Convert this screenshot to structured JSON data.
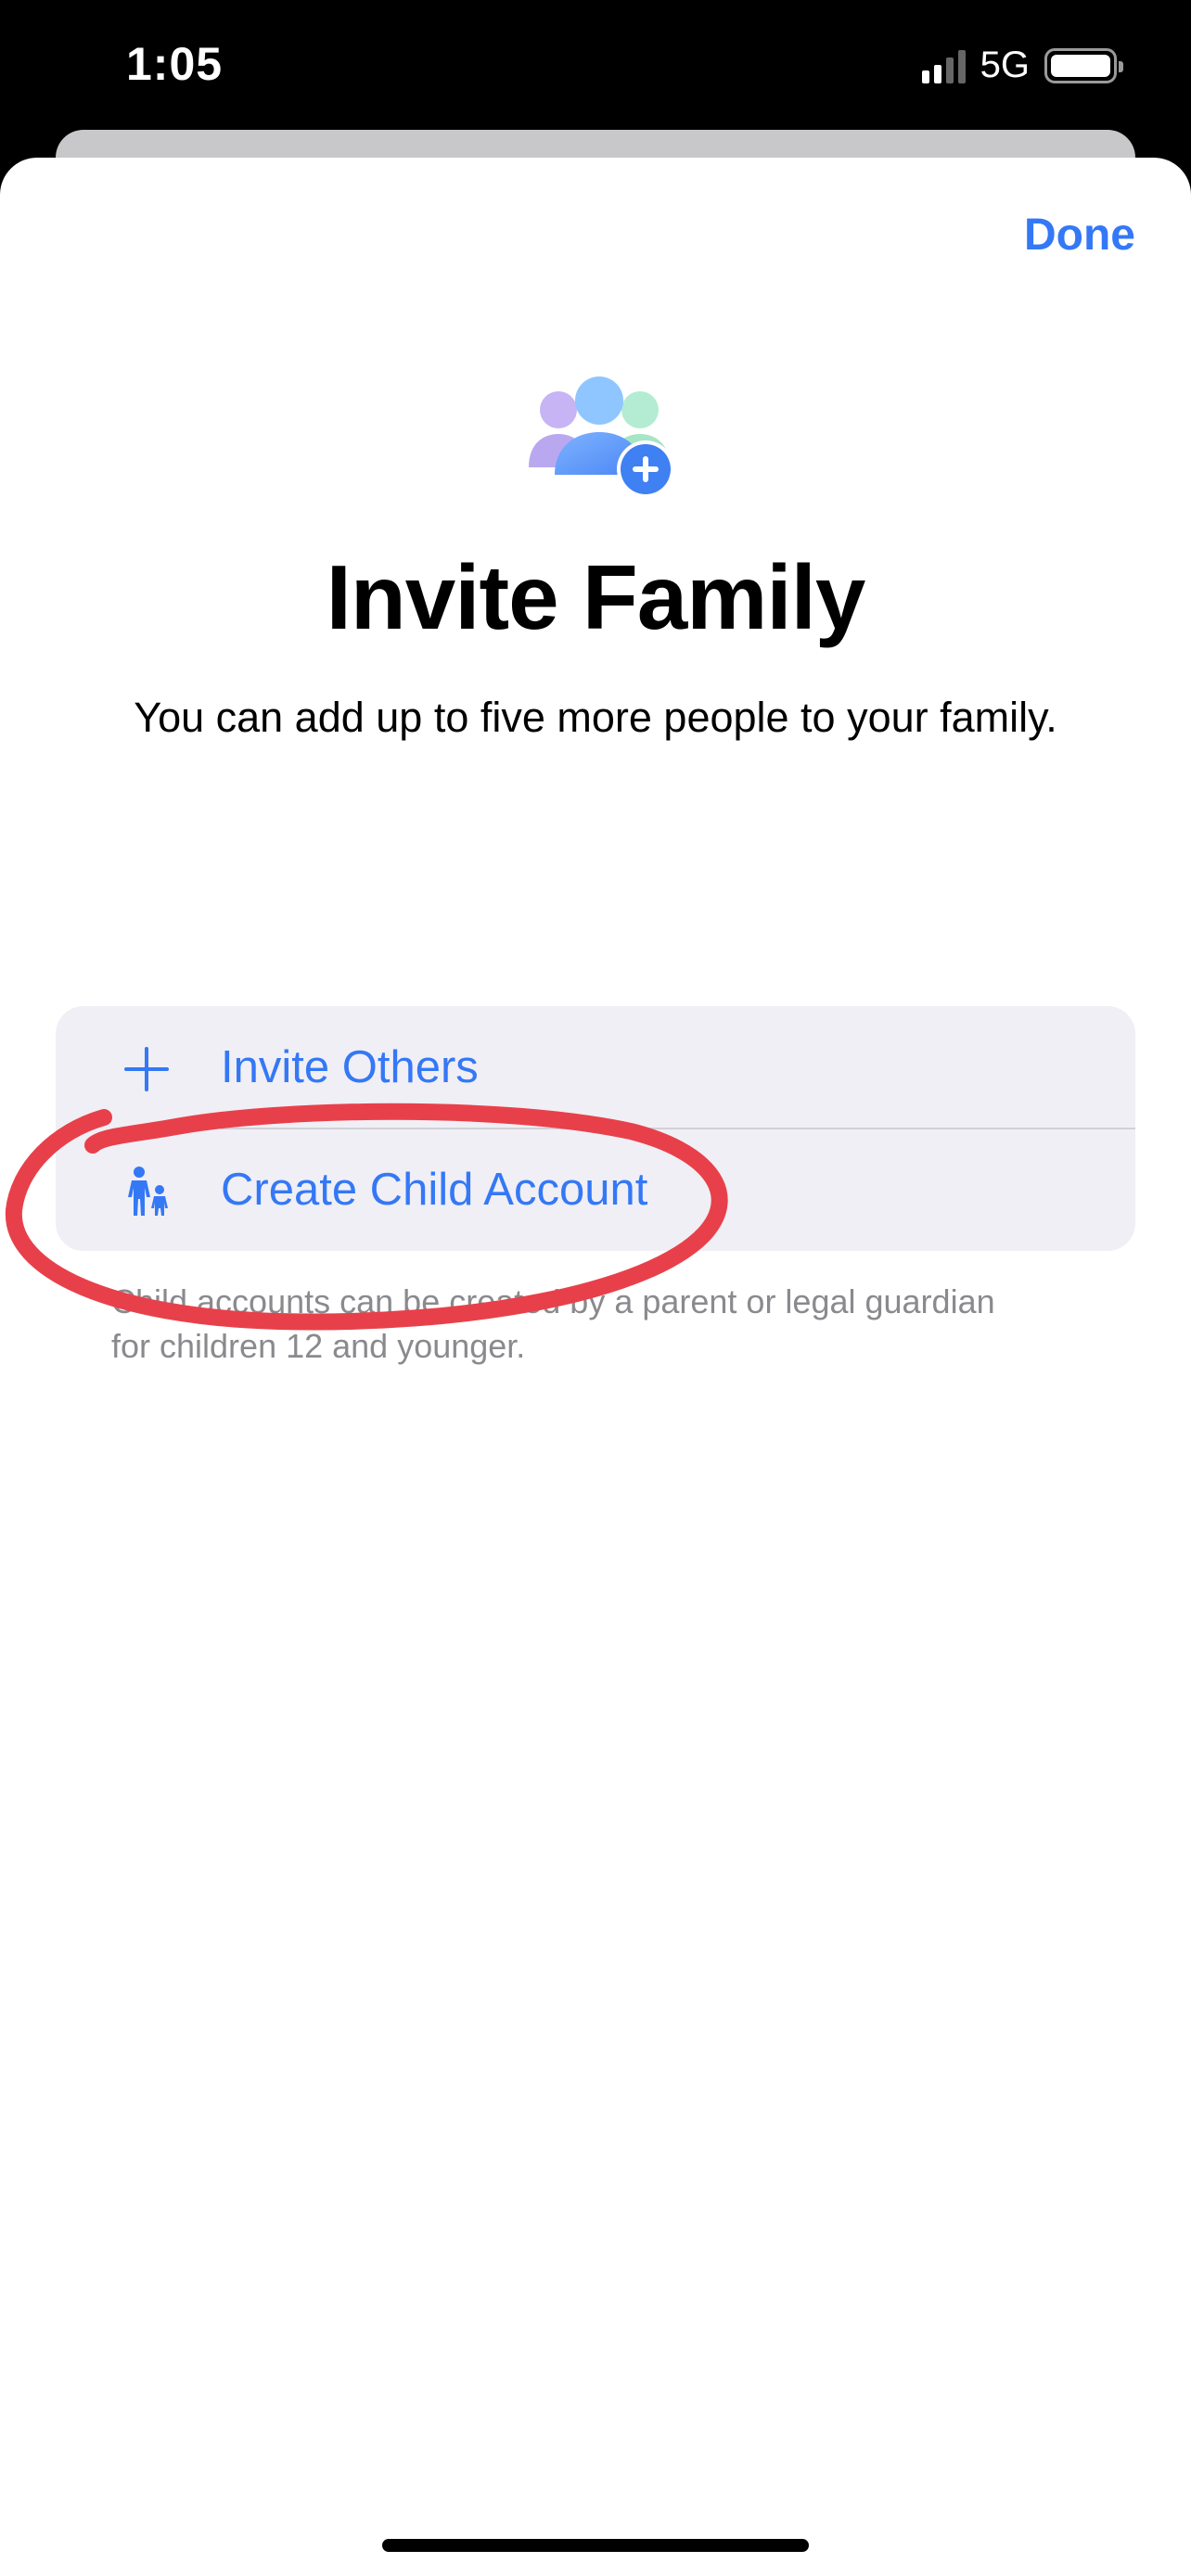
{
  "status_bar": {
    "time": "1:05",
    "network": "5G"
  },
  "sheet": {
    "done_label": "Done",
    "title": "Invite Family",
    "subtitle": "You can add up to five more people to your family.",
    "options": [
      {
        "label": "Invite Others",
        "icon": "plus-icon"
      },
      {
        "label": "Create Child Account",
        "icon": "parent-child-icon"
      }
    ],
    "footer_note": "Child accounts can be created by a parent or legal guardian for children 12 and younger."
  },
  "colors": {
    "accent": "#3478f6",
    "annotation": "#e8404a",
    "group_background": "#f0eff5",
    "footer_text": "#8a8a8e"
  },
  "icons": {
    "hero": "family-add-icon",
    "annotation": "red-circle-annotation"
  }
}
